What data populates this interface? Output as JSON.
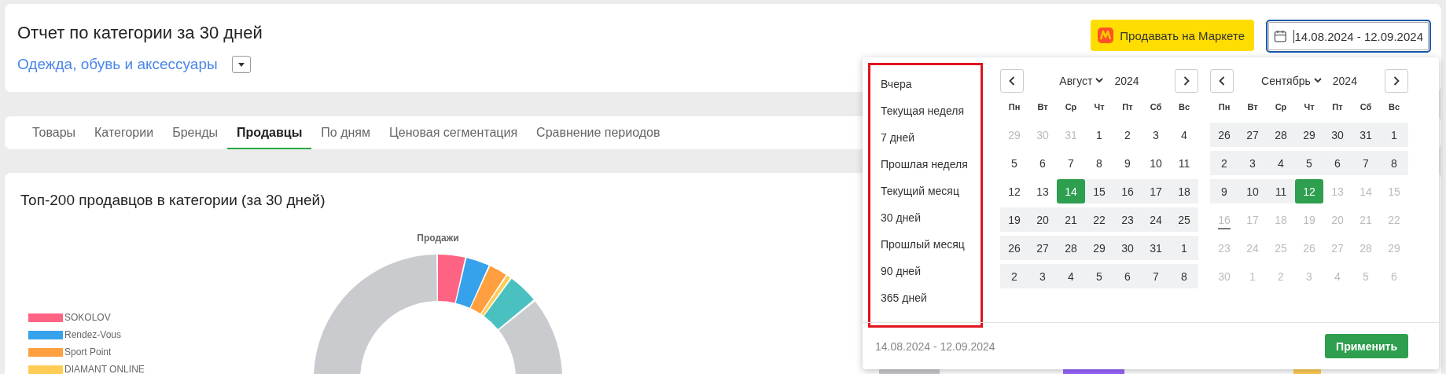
{
  "header": {
    "title": "Отчет по категории за 30 дней",
    "category": "Одежда, обувь и аксессуары",
    "market_button": "Продавать на Маркете",
    "date_range": "14.08.2024 - 12.09.2024"
  },
  "tabs": [
    {
      "label": "Товары",
      "selected": false
    },
    {
      "label": "Категории",
      "selected": false
    },
    {
      "label": "Бренды",
      "selected": false
    },
    {
      "label": "Продавцы",
      "selected": true
    },
    {
      "label": "По дням",
      "selected": false
    },
    {
      "label": "Ценовая сегментация",
      "selected": false
    },
    {
      "label": "Сравнение периодов",
      "selected": false
    }
  ],
  "chart_card": {
    "title": "Топ-200 продавцов в категории (за 30 дней)",
    "donut_title": "Продажи",
    "legend": [
      {
        "name": "SOKOLOV",
        "color": "#ff6384"
      },
      {
        "name": "Rendez-Vous",
        "color": "#36a2eb"
      },
      {
        "name": "Sport Point",
        "color": "#ff9f40"
      },
      {
        "name": "DIAMANT ONLINE",
        "color": "#ffcd56"
      }
    ]
  },
  "date_picker": {
    "presets": [
      "Вчера",
      "Текущая неделя",
      "7 дней",
      "Прошлая неделя",
      "Текущий месяц",
      "30 дней",
      "Прошлый месяц",
      "90 дней",
      "365 дней"
    ],
    "months": [
      {
        "month": "Август",
        "year": "2024",
        "weekdays": [
          "Пн",
          "Вт",
          "Ср",
          "Чт",
          "Пт",
          "Сб",
          "Вс"
        ],
        "days": [
          {
            "d": "29",
            "kind": "muted"
          },
          {
            "d": "30",
            "kind": "muted"
          },
          {
            "d": "31",
            "kind": "muted"
          },
          {
            "d": "1",
            "kind": "plain"
          },
          {
            "d": "2",
            "kind": "plain"
          },
          {
            "d": "3",
            "kind": "plain"
          },
          {
            "d": "4",
            "kind": "plain"
          },
          {
            "d": "5",
            "kind": "plain"
          },
          {
            "d": "6",
            "kind": "plain"
          },
          {
            "d": "7",
            "kind": "plain"
          },
          {
            "d": "8",
            "kind": "plain"
          },
          {
            "d": "9",
            "kind": "plain"
          },
          {
            "d": "10",
            "kind": "plain"
          },
          {
            "d": "11",
            "kind": "plain"
          },
          {
            "d": "12",
            "kind": "plain"
          },
          {
            "d": "13",
            "kind": "plain"
          },
          {
            "d": "14",
            "kind": "edge"
          },
          {
            "d": "15",
            "kind": "range"
          },
          {
            "d": "16",
            "kind": "range"
          },
          {
            "d": "17",
            "kind": "range"
          },
          {
            "d": "18",
            "kind": "range"
          },
          {
            "d": "19",
            "kind": "range"
          },
          {
            "d": "20",
            "kind": "range"
          },
          {
            "d": "21",
            "kind": "range"
          },
          {
            "d": "22",
            "kind": "range"
          },
          {
            "d": "23",
            "kind": "range"
          },
          {
            "d": "24",
            "kind": "range"
          },
          {
            "d": "25",
            "kind": "range"
          },
          {
            "d": "26",
            "kind": "range"
          },
          {
            "d": "27",
            "kind": "range"
          },
          {
            "d": "28",
            "kind": "range"
          },
          {
            "d": "29",
            "kind": "range"
          },
          {
            "d": "30",
            "kind": "range"
          },
          {
            "d": "31",
            "kind": "range"
          },
          {
            "d": "1",
            "kind": "range"
          },
          {
            "d": "2",
            "kind": "range"
          },
          {
            "d": "3",
            "kind": "range"
          },
          {
            "d": "4",
            "kind": "range"
          },
          {
            "d": "5",
            "kind": "range"
          },
          {
            "d": "6",
            "kind": "range"
          },
          {
            "d": "7",
            "kind": "range"
          },
          {
            "d": "8",
            "kind": "range"
          }
        ]
      },
      {
        "month": "Сентябрь",
        "year": "2024",
        "weekdays": [
          "Пн",
          "Вт",
          "Ср",
          "Чт",
          "Пт",
          "Сб",
          "Вс"
        ],
        "days": [
          {
            "d": "26",
            "kind": "range"
          },
          {
            "d": "27",
            "kind": "range"
          },
          {
            "d": "28",
            "kind": "range"
          },
          {
            "d": "29",
            "kind": "range"
          },
          {
            "d": "30",
            "kind": "range"
          },
          {
            "d": "31",
            "kind": "range"
          },
          {
            "d": "1",
            "kind": "range"
          },
          {
            "d": "2",
            "kind": "range"
          },
          {
            "d": "3",
            "kind": "range"
          },
          {
            "d": "4",
            "kind": "range"
          },
          {
            "d": "5",
            "kind": "range"
          },
          {
            "d": "6",
            "kind": "range"
          },
          {
            "d": "7",
            "kind": "range"
          },
          {
            "d": "8",
            "kind": "range"
          },
          {
            "d": "9",
            "kind": "range"
          },
          {
            "d": "10",
            "kind": "range"
          },
          {
            "d": "11",
            "kind": "range"
          },
          {
            "d": "12",
            "kind": "edge"
          },
          {
            "d": "13",
            "kind": "muted"
          },
          {
            "d": "14",
            "kind": "muted"
          },
          {
            "d": "15",
            "kind": "muted"
          },
          {
            "d": "16",
            "kind": "today"
          },
          {
            "d": "17",
            "kind": "muted"
          },
          {
            "d": "18",
            "kind": "muted"
          },
          {
            "d": "19",
            "kind": "muted"
          },
          {
            "d": "20",
            "kind": "muted"
          },
          {
            "d": "21",
            "kind": "muted"
          },
          {
            "d": "22",
            "kind": "muted"
          },
          {
            "d": "23",
            "kind": "muted"
          },
          {
            "d": "24",
            "kind": "muted"
          },
          {
            "d": "25",
            "kind": "muted"
          },
          {
            "d": "26",
            "kind": "muted"
          },
          {
            "d": "27",
            "kind": "muted"
          },
          {
            "d": "28",
            "kind": "muted"
          },
          {
            "d": "29",
            "kind": "muted"
          },
          {
            "d": "30",
            "kind": "muted"
          },
          {
            "d": "1",
            "kind": "muted"
          },
          {
            "d": "2",
            "kind": "muted"
          },
          {
            "d": "3",
            "kind": "muted"
          },
          {
            "d": "4",
            "kind": "muted"
          },
          {
            "d": "5",
            "kind": "muted"
          },
          {
            "d": "6",
            "kind": "muted"
          }
        ]
      }
    ],
    "footer_range": "14.08.2024 - 12.09.2024",
    "apply_button": "Применить"
  }
}
